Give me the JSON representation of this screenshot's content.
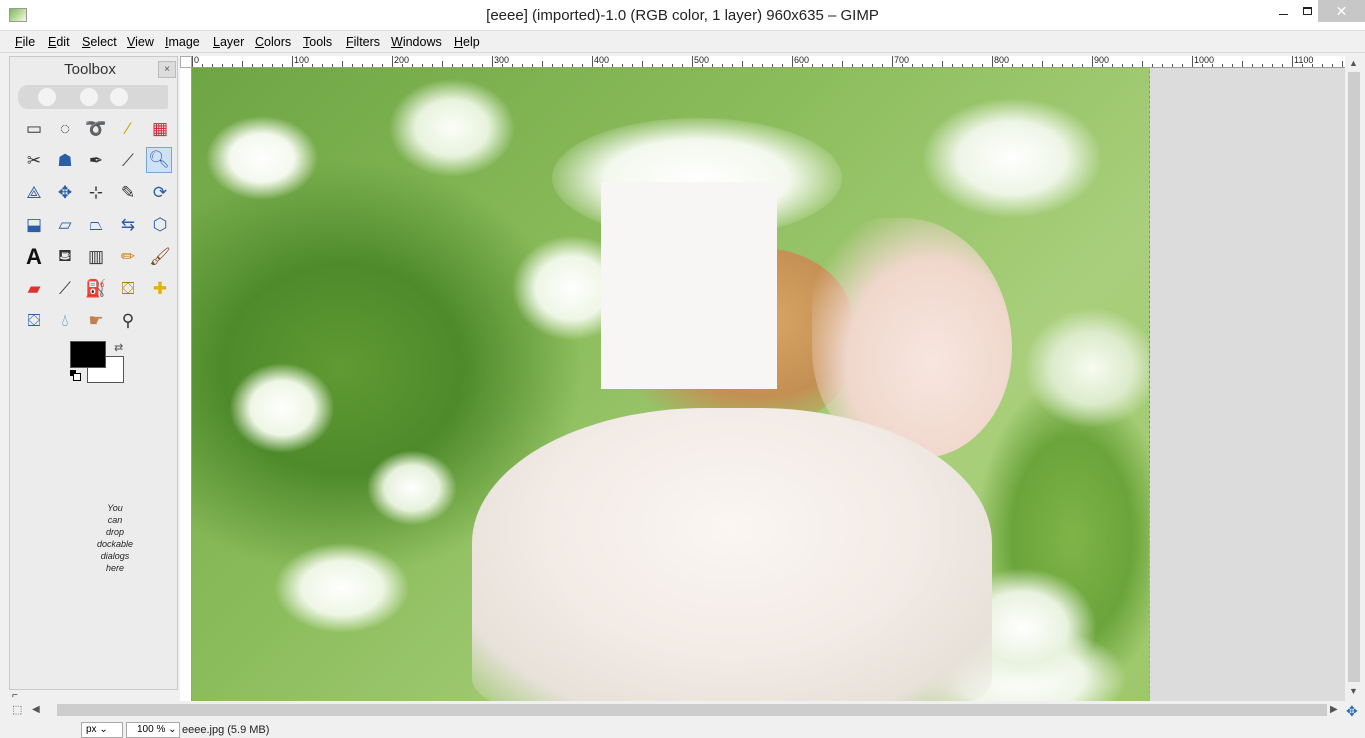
{
  "window": {
    "title": "[eeee] (imported)-1.0 (RGB color, 1 layer) 960x635 – GIMP",
    "minimize_label": "",
    "maximize_label": "",
    "close_label": "✕"
  },
  "menubar": {
    "items": [
      "File",
      "Edit",
      "Select",
      "View",
      "Image",
      "Layer",
      "Colors",
      "Tools",
      "Filters",
      "Windows",
      "Help"
    ]
  },
  "toolbox": {
    "title": "Toolbox",
    "close_label": "×",
    "drop_hint": [
      "You",
      "can",
      "drop",
      "dockable",
      "dialogs",
      "here"
    ],
    "fg_color": "#000000",
    "bg_color": "#ffffff",
    "active_tool": "zoom",
    "tools": [
      [
        "rect-select",
        "ellipse-select",
        "free-select",
        "fuzzy-select",
        "select-by-color"
      ],
      [
        "scissors-select",
        "foreground-select",
        "paths",
        "color-picker",
        "zoom"
      ],
      [
        "measure",
        "move",
        "align",
        "crop",
        "rotate"
      ],
      [
        "scale",
        "shear",
        "perspective",
        "flip",
        "cage-transform"
      ],
      [
        "text",
        "bucket-fill",
        "blend",
        "pencil",
        "paintbrush"
      ],
      [
        "eraser",
        "airbrush",
        "ink",
        "clone",
        "heal"
      ],
      [
        "perspective-clone",
        "blur",
        "smudge",
        "dodge-burn"
      ]
    ]
  },
  "ruler": {
    "labels": [
      "0",
      "100",
      "200",
      "300",
      "400",
      "500",
      "600",
      "700",
      "800",
      "900",
      "1000",
      "1100"
    ]
  },
  "canvas": {
    "image_width": 960,
    "image_height": 635
  },
  "statusbar": {
    "unit": "px",
    "zoom": "100 %",
    "file_info": "eeee.jpg (5.9 MB)"
  }
}
